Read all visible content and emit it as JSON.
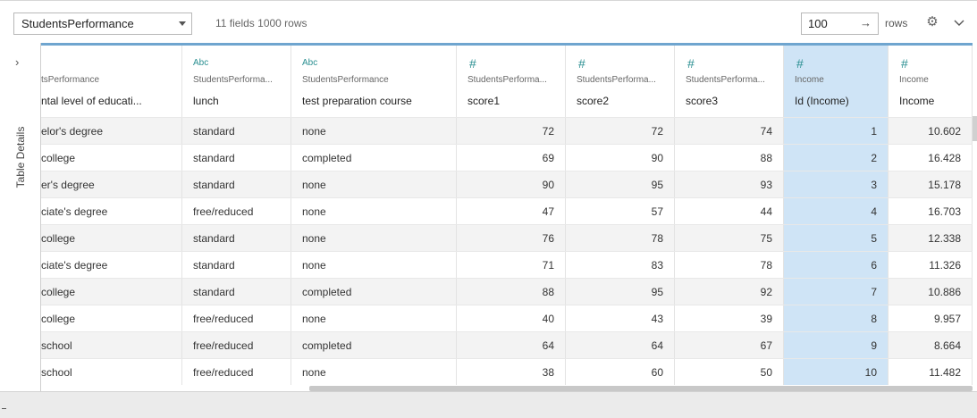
{
  "toolbar": {
    "datasource": "StudentsPerformance",
    "meta": "11 fields 1000 rows",
    "rows_value": "100",
    "rows_label": "rows"
  },
  "side": {
    "label": "Table Details"
  },
  "columns": [
    {
      "type": "",
      "source": "tsPerformance",
      "name": "ntal level of educati..."
    },
    {
      "type": "Abc",
      "source": "StudentsPerforma...",
      "name": "lunch"
    },
    {
      "type": "Abc",
      "source": "StudentsPerformance",
      "name": "test preparation course"
    },
    {
      "type": "#",
      "source": "StudentsPerforma...",
      "name": "score1"
    },
    {
      "type": "#",
      "source": "StudentsPerforma...",
      "name": "score2"
    },
    {
      "type": "#",
      "source": "StudentsPerforma...",
      "name": "score3"
    },
    {
      "type": "#",
      "source": "Income",
      "name": "Id (Income)"
    },
    {
      "type": "#",
      "source": "Income",
      "name": "Income"
    }
  ],
  "rows": [
    [
      "elor's degree",
      "standard",
      "none",
      "72",
      "72",
      "74",
      "1",
      "10.602"
    ],
    [
      " college",
      "standard",
      "completed",
      "69",
      "90",
      "88",
      "2",
      "16.428"
    ],
    [
      "er's degree",
      "standard",
      "none",
      "90",
      "95",
      "93",
      "3",
      "15.178"
    ],
    [
      "ciate's degree",
      "free/reduced",
      "none",
      "47",
      "57",
      "44",
      "4",
      "16.703"
    ],
    [
      " college",
      "standard",
      "none",
      "76",
      "78",
      "75",
      "5",
      "12.338"
    ],
    [
      "ciate's degree",
      "standard",
      "none",
      "71",
      "83",
      "78",
      "6",
      "11.326"
    ],
    [
      " college",
      "standard",
      "completed",
      "88",
      "95",
      "92",
      "7",
      "10.886"
    ],
    [
      " college",
      "free/reduced",
      "none",
      "40",
      "43",
      "39",
      "8",
      "9.957"
    ],
    [
      "school",
      "free/reduced",
      "completed",
      "64",
      "64",
      "67",
      "9",
      "8.664"
    ],
    [
      "school",
      "free/reduced",
      "none",
      "38",
      "60",
      "50",
      "10",
      "11.482"
    ]
  ]
}
